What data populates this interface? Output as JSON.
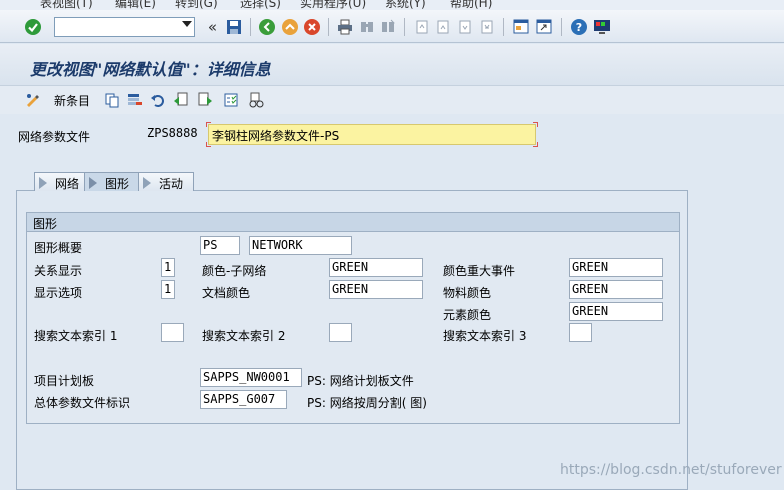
{
  "menubar": {
    "items": [
      "表视图(T)",
      "编辑(E)",
      "转到(G)",
      "选择(S)",
      "实用程序(U)",
      "系统(Y)",
      "帮助(H)"
    ]
  },
  "toolbar": {
    "command_field_value": ""
  },
  "header": {
    "title": "更改视图\"网络默认值\"：详细信息"
  },
  "app_toolbar": {
    "new_entries_label": "新条目"
  },
  "key_fields": {
    "network_profile_label": "网络参数文件",
    "network_profile_value": "ZPS8888",
    "network_profile_desc": "李钢柱网络参数文件-PS"
  },
  "tabs": [
    {
      "label": "网络"
    },
    {
      "label": "图形"
    },
    {
      "label": "活动"
    }
  ],
  "graphic": {
    "group_title": "图形",
    "overview_label": "图形概要",
    "overview_value1": "PS",
    "overview_value2": "NETWORK",
    "relation_label": "关系显示",
    "relation_value": "1",
    "display_options_label": "显示选项",
    "display_options_value": "1",
    "subnet_color_label": "颜色-子网络",
    "subnet_color_value": "GREEN",
    "doc_color_label": "文档颜色",
    "doc_color_value": "GREEN",
    "milestone_color_label": "颜色重大事件",
    "milestone_color_value": "GREEN",
    "material_color_label": "物料颜色",
    "material_color_value": "GREEN",
    "element_color_label": "元素颜色",
    "element_color_value": "GREEN",
    "search1_label": "搜索文本索引 1",
    "search2_label": "搜索文本索引 2",
    "search3_label": "搜索文本索引 3",
    "project_board_label": "项目计划板",
    "project_board_value": "SAPPS_NW0001",
    "project_board_desc": "PS: 网络计划板文件",
    "overall_profile_label": "总体参数文件标识",
    "overall_profile_value": "SAPPS_G007",
    "overall_profile_desc": "PS: 网络按周分割( 图)"
  },
  "watermark": "https://blog.csdn.net/stuforever"
}
